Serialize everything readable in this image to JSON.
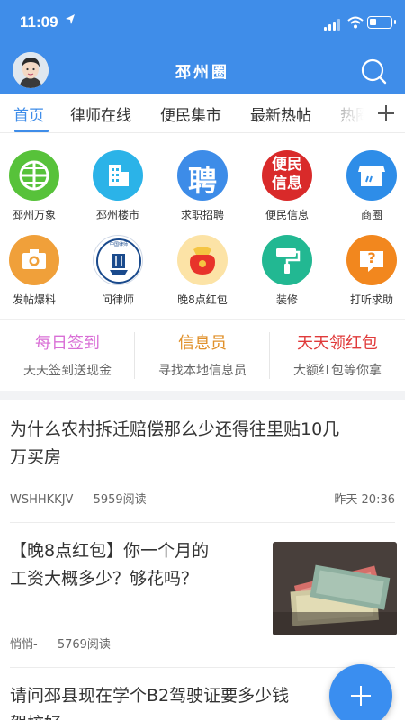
{
  "status_bar": {
    "time": "11:09"
  },
  "header": {
    "title": "邳州圈"
  },
  "tabs": [
    {
      "label": "首页"
    },
    {
      "label": "律师在线"
    },
    {
      "label": "便民集市"
    },
    {
      "label": "最新热帖"
    },
    {
      "label": "热圈"
    }
  ],
  "grid": [
    {
      "label": "邳州万象",
      "icon": "globe-icon",
      "color": "#57c23a"
    },
    {
      "label": "邳州楼市",
      "icon": "building-icon",
      "color": "#2bb3e8"
    },
    {
      "label": "求职招聘",
      "icon": "recruit-icon",
      "color": "#3d8ce8",
      "glyph": "聘"
    },
    {
      "label": "便民信息",
      "icon": "info-icon",
      "color": "#d92a2a",
      "glyph": "便民信息"
    },
    {
      "label": "商圈",
      "icon": "shop-icon",
      "color": "#2e8de8"
    },
    {
      "label": "发帖爆料",
      "icon": "camera-icon",
      "color": "#f0a03a"
    },
    {
      "label": "问律师",
      "icon": "lawyer-icon",
      "color": "#1a4a8c",
      "glyph": "中国律师"
    },
    {
      "label": "晚8点红包",
      "icon": "red-packet-icon",
      "color": "#e8332a"
    },
    {
      "label": "装修",
      "icon": "paint-roller-icon",
      "color": "#22b892"
    },
    {
      "label": "打听求助",
      "icon": "help-icon",
      "color": "#f2871e",
      "glyph": "?"
    }
  ],
  "promos": [
    {
      "title": "每日签到",
      "subtitle": "天天签到送现金",
      "color": "#d96fd6"
    },
    {
      "title": "信息员",
      "subtitle": "寻找本地信息员",
      "color": "#e0902a"
    },
    {
      "title": "天天领红包",
      "subtitle": "大额红包等你拿",
      "color": "#e03a3a"
    }
  ],
  "articles": [
    {
      "title_line1": "为什么农村拆迁赔偿那么少还得往里贴10几",
      "title_line2": "万买房",
      "author": "WSHHKKJV",
      "reads": "5959阅读",
      "time": "昨天 20:36"
    },
    {
      "title_line1": "【晚8点红包】你一个月的",
      "title_line2": "工资大概多少？够花吗？",
      "author": "悄悄-",
      "reads": "5769阅读"
    },
    {
      "title_line1": "请问邳县现在学个B2驾驶证要多少钱",
      "title_line2": "驾校好"
    }
  ]
}
